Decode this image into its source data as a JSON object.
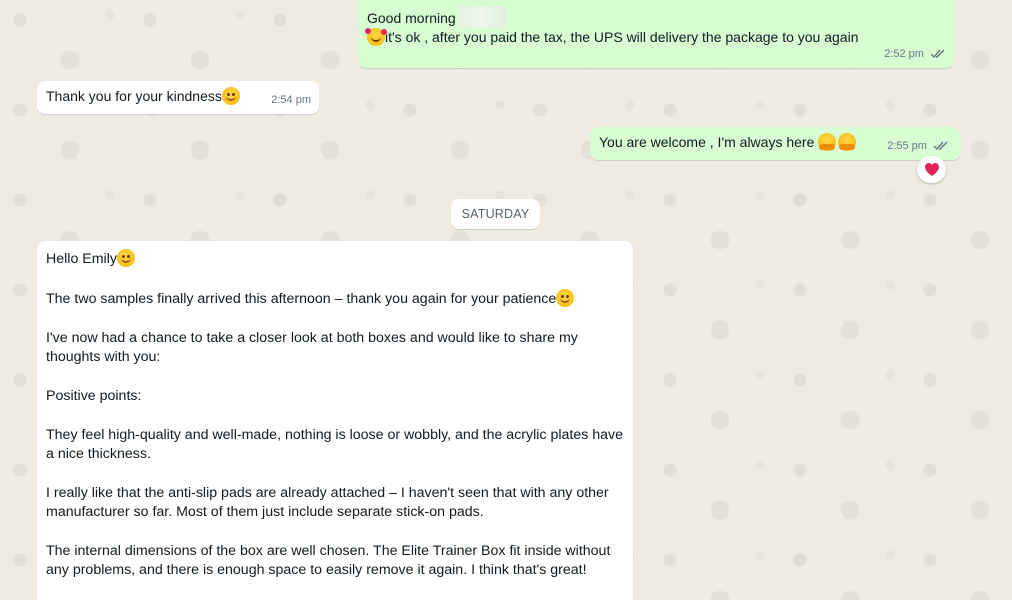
{
  "chat": {
    "messages": [
      {
        "direction": "outgoing",
        "line1": "Good morning",
        "line2": "it's ok , after you paid the tax, the UPS will delivery the package to you again",
        "time": "2:52 pm",
        "status": "read"
      },
      {
        "direction": "incoming",
        "text": "Thank you for your kindness",
        "time": "2:54 pm"
      },
      {
        "direction": "outgoing",
        "text": "You are welcome , I'm always here ",
        "time": "2:55 pm",
        "status": "read",
        "reaction": "heart-icon"
      }
    ],
    "date_divider": "SATURDAY",
    "long_message": {
      "direction": "incoming",
      "paragraphs": [
        "Hello Emily",
        "The two samples finally arrived this afternoon – thank you again for your patience",
        "I've now had a chance to take a closer look at both boxes and would like to share my thoughts with you:",
        "Positive points:",
        "They feel high-quality and well-made, nothing is loose or wobbly, and the acrylic plates have a nice thickness.",
        "I really like that the anti-slip pads are already attached – I haven't seen that with any other manufacturer so far. Most of them just include separate stick-on pads.",
        "The internal dimensions of the box are well chosen. The Elite Trainer Box fit inside without any problems, and there is enough space to easily remove it again. I think that's great!"
      ]
    }
  },
  "colors": {
    "outgoing_bubble": "#d9fdd3",
    "incoming_bubble": "#ffffff",
    "chat_background": "#efeae2",
    "read_ticks": "#667781",
    "heart": "#e3245b"
  }
}
